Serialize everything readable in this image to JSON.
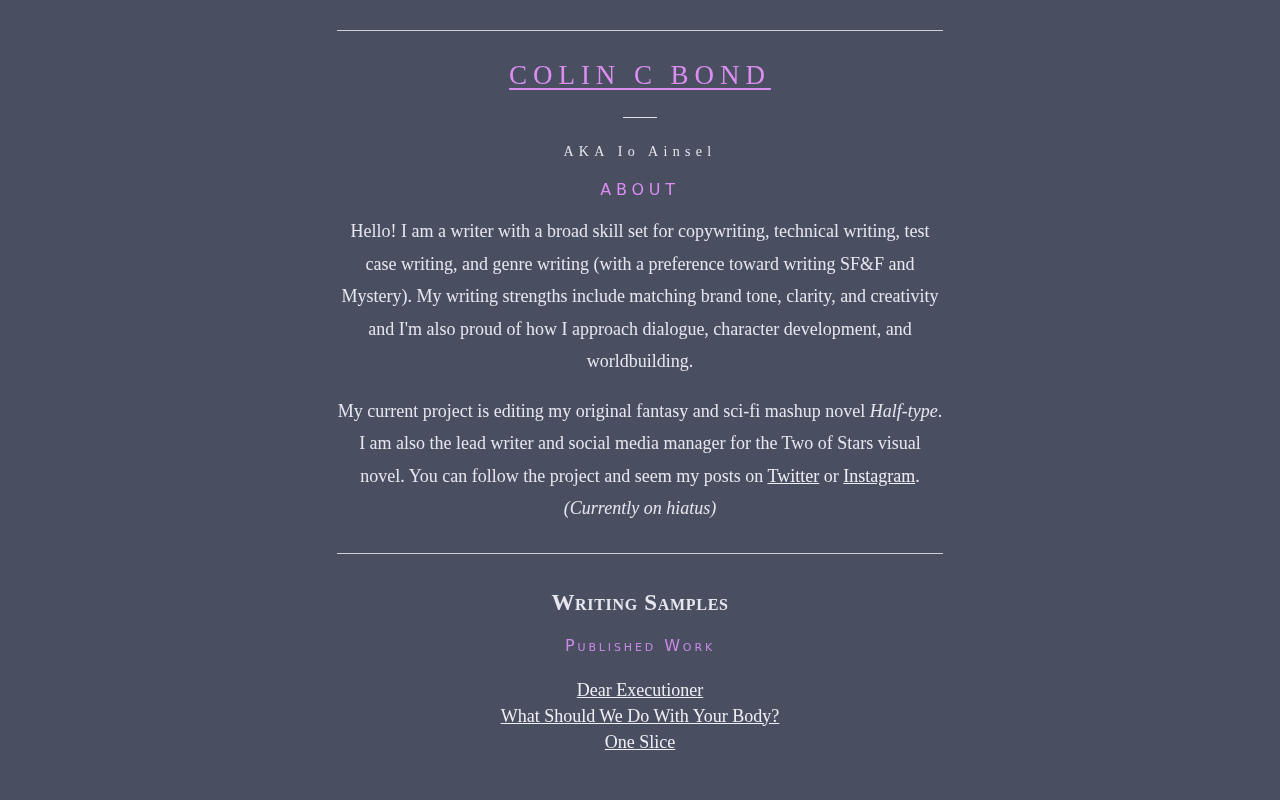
{
  "header": {
    "title": "COLIN C BOND",
    "alias": "AKA Io Ainsel"
  },
  "about": {
    "heading": "ABOUT",
    "paragraphs": [
      [
        {
          "kind": "text",
          "text": "Hello! I am a writer with a broad skill set for copywriting, technical writing, test case writing, and genre writing (with a preference toward writing SF&F and Mystery). My writing strengths include matching brand tone, clarity, and creativity and I'm also proud of how I approach dialogue, character development, and worldbuilding."
        }
      ],
      [
        {
          "kind": "text",
          "text": "My current project is editing my original fantasy and sci-fi mashup novel *Half-type*. I am also the lead writer and social media manager for the Two of Stars visual novel. You can follow the project and seem my posts on "
        },
        {
          "kind": "link",
          "text": "Twitter"
        },
        {
          "kind": "text",
          "text": " or "
        },
        {
          "kind": "link",
          "text": "Instagram"
        },
        {
          "kind": "text",
          "text": ". *(Currently on hiatus)*"
        }
      ]
    ]
  },
  "samples": {
    "heading": "Writing Samples",
    "subheading": "Published Work",
    "links": [
      "Dear Executioner",
      "What Should We Do With Your Body?",
      "One Slice"
    ]
  }
}
